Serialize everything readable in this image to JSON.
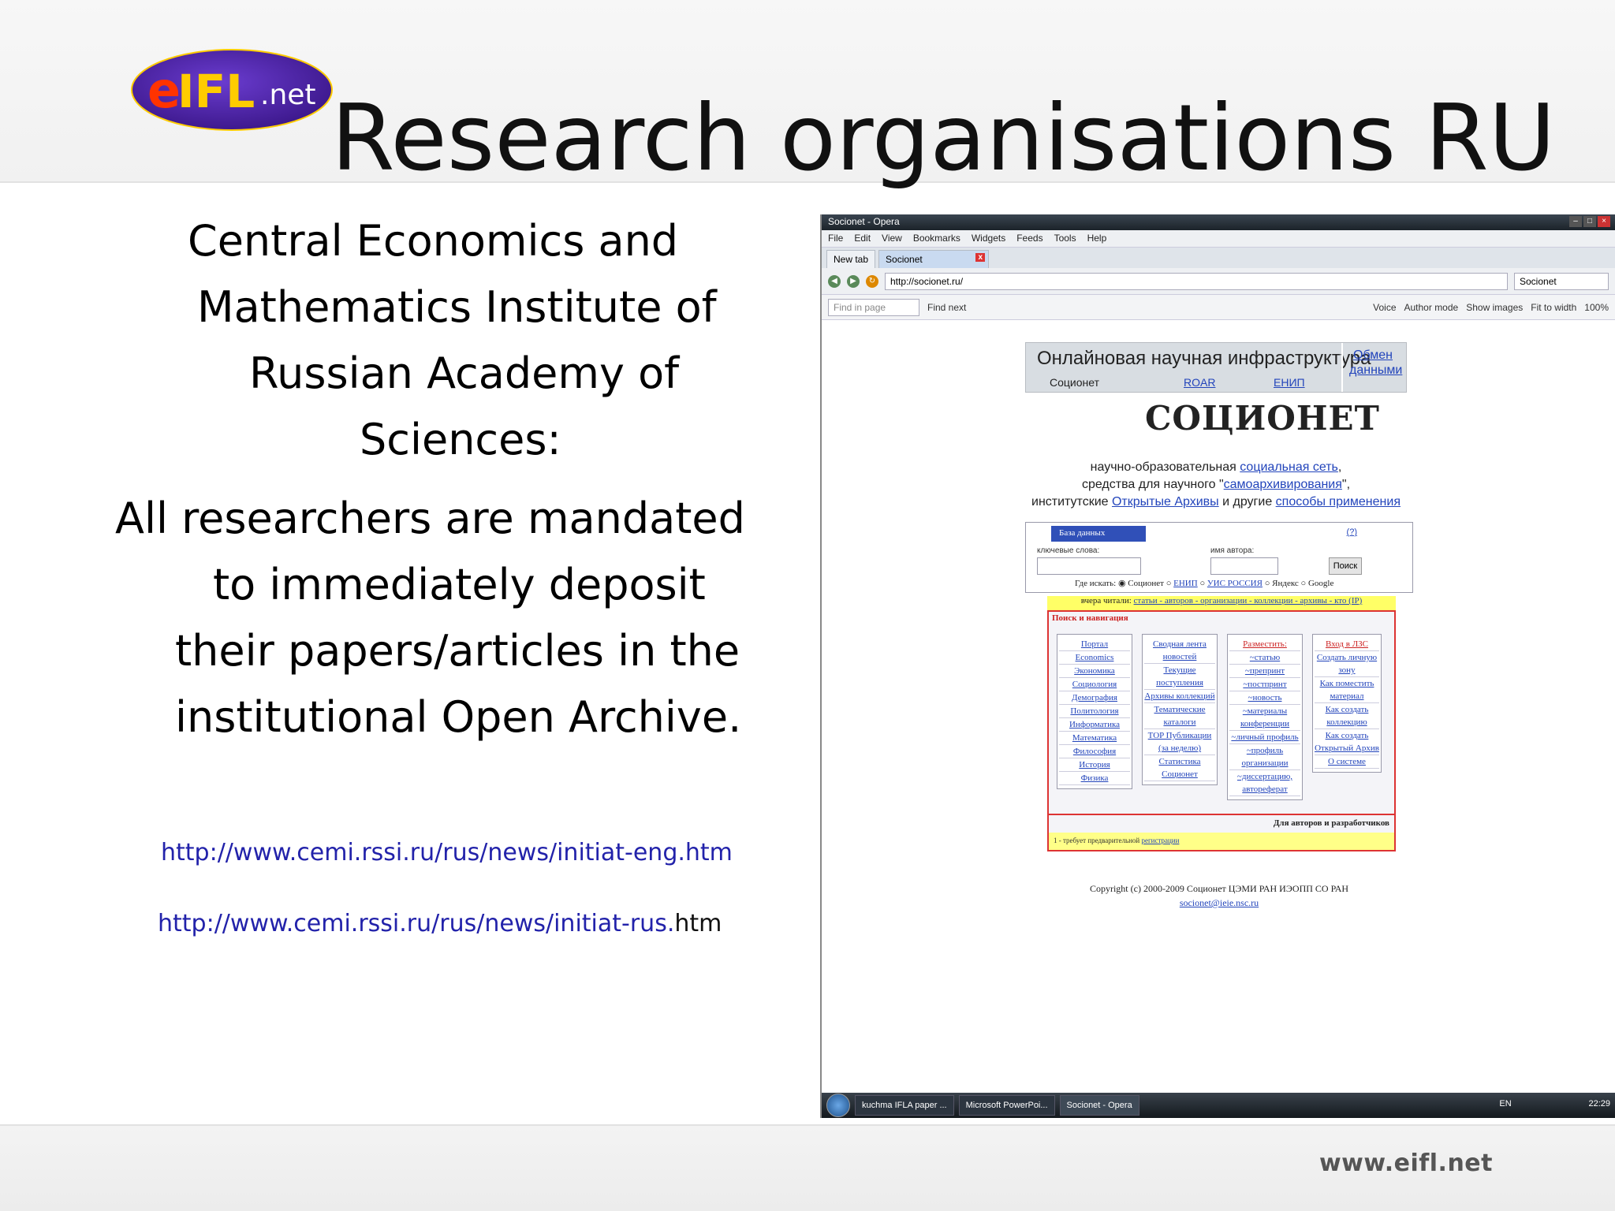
{
  "slide": {
    "title": "Research organisations RU",
    "logo_text": "eIFL.net",
    "body_heading": [
      "Central Economics and",
      "Mathematics Institute of",
      "Russian Academy of",
      "Sciences:"
    ],
    "body_text": [
      "All researchers are mandated",
      "to immediately deposit",
      "their papers/articles in the",
      "institutional Open Archive."
    ],
    "links": [
      {
        "text": "http://www.cemi.rssi.ru/rus/news/initiat-eng.htm",
        "tail": ""
      },
      {
        "text": "http://www.cemi.rssi.ru/rus/news/initiat-rus.",
        "tail": "htm"
      }
    ],
    "footer_url": "www.eifl.net"
  },
  "browser": {
    "window_title": "Socionet - Opera",
    "menu": [
      "File",
      "Edit",
      "View",
      "Bookmarks",
      "Widgets",
      "Feeds",
      "Tools",
      "Help"
    ],
    "tabs": [
      {
        "label": "New tab"
      },
      {
        "label": "Socionet"
      }
    ],
    "address": "http://socionet.ru/",
    "search_engine": "Socionet",
    "find_placeholder": "Find in page",
    "find_next": "Find next",
    "toolbar_right": [
      "Voice",
      "Author mode",
      "Show images",
      "Fit to width",
      "100%"
    ]
  },
  "page": {
    "banner_title": "Онлайновая научная инфраструктура",
    "banner_sub": "Соционет",
    "banner_link1": "ROAR",
    "banner_link2": "ЕНИП",
    "banner_exchange": "Обмен данными",
    "logo": "СОЦИОНЕТ",
    "desc": {
      "l1a": "научно-образовательная ",
      "l1b": "социальная сеть",
      "l2a": "средства для научного \"",
      "l2b": "самоархивирования",
      "l2c": "\",",
      "l3a": "институтские ",
      "l3b": "Открытые Архивы",
      "l3c": " и другие ",
      "l3d": "способы применения"
    },
    "db": {
      "header": "База данных",
      "keywords_label": "ключевые слова:",
      "author_label": "имя автора:",
      "search_button": "Поиск",
      "where": "Где искать:",
      "options": [
        "Соционет",
        "ЕНИП",
        "УИС РОССИЯ",
        "Яндекс",
        "Google"
      ]
    },
    "yesterday": "вчера читали:",
    "yesterday_links": "статьи - авторов - организации - коллекции - архивы - кто (IP)",
    "nav_heading": "Поиск и навигация",
    "col1": [
      "Портал",
      "Economics",
      "Экономика",
      "Социология",
      "Демография",
      "Политология",
      "Информатика",
      "Математика",
      "Философия",
      "История",
      "Физика"
    ],
    "col2": [
      "Сводная лента новостей",
      "Текущие поступления",
      "Архивы коллекций",
      "Тематические каталоги",
      "TOP Публикации (за неделю)",
      "Статистика Соционет"
    ],
    "col3_head": "Разместить:",
    "col3": [
      "~статью",
      "~препринт",
      "~постпринт",
      "~новость",
      "~материалы конференции",
      "~личный профиль",
      "~профиль организации",
      "~диссертацию, автореферат"
    ],
    "col4_head": "Вход в ЛЗС",
    "col4": [
      "Создать личную зону",
      "Как поместить материал",
      "Как создать коллекцию",
      "Как создать Открытый Архив",
      "О системе"
    ],
    "authors_bar": "Для авторов и разработчиков",
    "reg_note": "1 - требует предварительной ",
    "reg_link": "регистрации",
    "copyright": "Copyright (c) 2000-2009 Соционет ЦЭМИ РАН ИЭОПП СО РАН",
    "email": "socionet@ieie.nsc.ru"
  },
  "taskbar": {
    "items": [
      "kuchma IFLA paper ...",
      "Microsoft PowerPoi...",
      "Socionet - Opera"
    ],
    "lang": "EN",
    "clock": "22:29"
  }
}
